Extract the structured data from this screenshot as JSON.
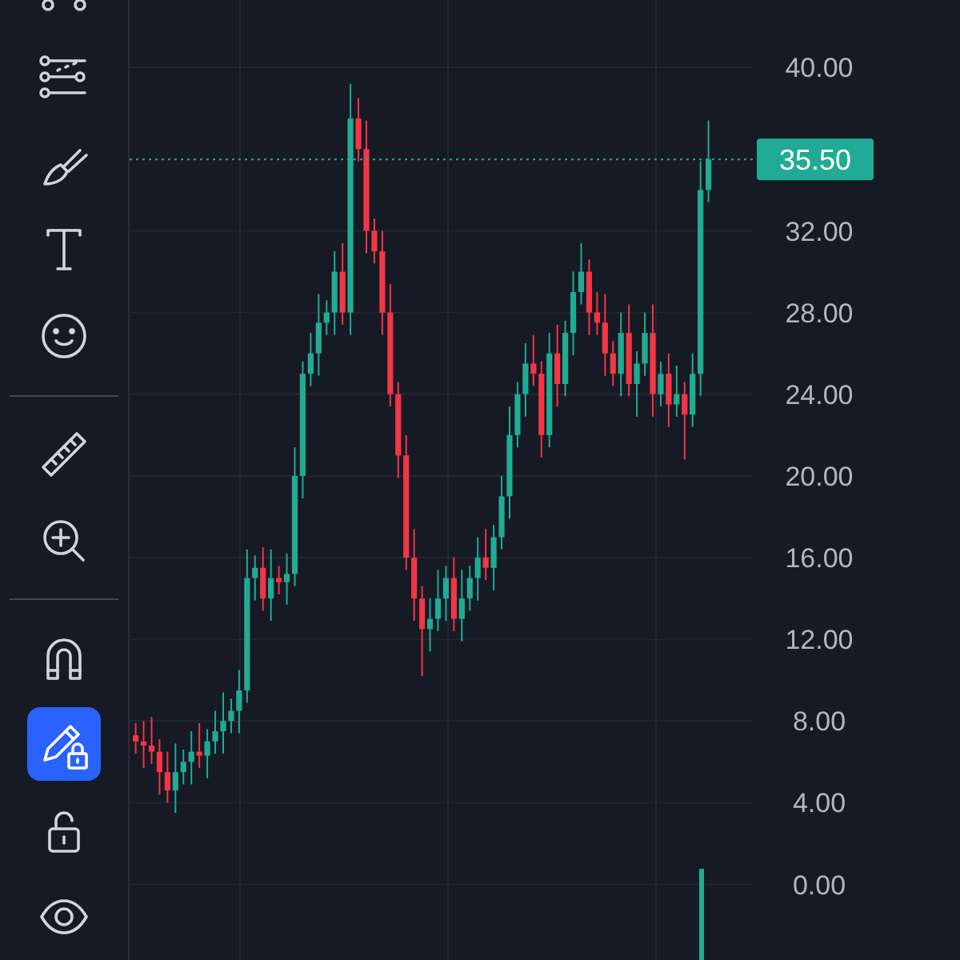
{
  "toolbar": {
    "tools": [
      {
        "kind": "nodes",
        "selected": false
      },
      {
        "kind": "fib",
        "selected": false
      },
      {
        "kind": "brush",
        "selected": false
      },
      {
        "kind": "text",
        "selected": false
      },
      {
        "kind": "emoji",
        "selected": false
      },
      {
        "kind": "separator"
      },
      {
        "kind": "ruler",
        "selected": false
      },
      {
        "kind": "zoom",
        "selected": false
      },
      {
        "kind": "separator"
      },
      {
        "kind": "magnet",
        "selected": false
      },
      {
        "kind": "lockdraw",
        "selected": true
      },
      {
        "kind": "unlock",
        "selected": false
      },
      {
        "kind": "eye",
        "selected": false
      }
    ]
  },
  "chart": {
    "chart_data": {
      "type": "candlestick",
      "ylim": [
        -3.7,
        43.3
      ],
      "yticks": [
        {
          "value": 40,
          "label": "40.00"
        },
        {
          "value": 32,
          "label": "32.00"
        },
        {
          "value": 28,
          "label": "28.00"
        },
        {
          "value": 24,
          "label": "24.00"
        },
        {
          "value": 20,
          "label": "20.00"
        },
        {
          "value": 16,
          "label": "16.00"
        },
        {
          "value": 12,
          "label": "12.00"
        },
        {
          "value": 8,
          "label": "8.00"
        },
        {
          "value": 4,
          "label": "4.00"
        },
        {
          "value": 0,
          "label": "0.00"
        }
      ],
      "ohlc": [
        [
          7.3,
          7.9,
          6.4,
          7
        ],
        [
          7,
          8,
          5.7,
          6.8
        ],
        [
          6.8,
          8.2,
          5.9,
          6.5
        ],
        [
          6.5,
          7.1,
          4.4,
          5.5
        ],
        [
          5.5,
          6.5,
          4,
          4.6
        ],
        [
          4.6,
          6.9,
          3.5,
          5.5
        ],
        [
          5.5,
          6.6,
          4.9,
          6
        ],
        [
          6,
          7.5,
          4.9,
          6.5
        ],
        [
          6.5,
          7.9,
          5.7,
          6.3
        ],
        [
          6.3,
          7.6,
          5.2,
          7
        ],
        [
          7,
          8.5,
          6.4,
          7.5
        ],
        [
          7.5,
          9.4,
          6.4,
          8
        ],
        [
          8,
          9.1,
          7.4,
          8.5
        ],
        [
          8.5,
          10.5,
          7.4,
          9.5
        ],
        [
          9.5,
          16.4,
          8.9,
          15
        ],
        [
          15,
          16.1,
          13.9,
          15.5
        ],
        [
          15.5,
          16.5,
          13.4,
          14
        ],
        [
          14,
          16.4,
          12.9,
          15
        ],
        [
          15,
          15.6,
          14.2,
          14.8
        ],
        [
          14.8,
          16.2,
          13.7,
          15.2
        ],
        [
          15.2,
          21.4,
          14.6,
          20
        ],
        [
          20,
          25.6,
          18.9,
          25
        ],
        [
          25,
          27,
          24.4,
          26
        ],
        [
          26,
          28.9,
          24.9,
          27.5
        ],
        [
          27.5,
          28.6,
          26.9,
          28
        ],
        [
          28,
          31,
          26.9,
          30
        ],
        [
          30,
          31.4,
          27.4,
          28
        ],
        [
          28,
          39.2,
          26.9,
          37.5
        ],
        [
          37.5,
          38.5,
          35.4,
          36
        ],
        [
          36,
          37.4,
          30.9,
          32
        ],
        [
          32,
          32.6,
          30.4,
          31
        ],
        [
          31,
          32,
          26.9,
          28
        ],
        [
          28,
          29.4,
          23.4,
          24
        ],
        [
          24,
          24.6,
          19.9,
          21
        ],
        [
          21,
          22,
          15.4,
          16
        ],
        [
          16,
          17.4,
          12.9,
          14
        ],
        [
          14,
          14.6,
          10.2,
          12.5
        ],
        [
          12.5,
          14,
          11.4,
          13
        ],
        [
          13,
          15.4,
          12.4,
          14
        ],
        [
          14,
          15.6,
          12.9,
          15
        ],
        [
          15,
          16,
          12.4,
          13
        ],
        [
          13,
          15.4,
          11.9,
          14
        ],
        [
          14,
          15.6,
          13.4,
          15
        ],
        [
          15,
          17,
          13.9,
          16
        ],
        [
          16,
          17.4,
          14.9,
          15.5
        ],
        [
          15.5,
          17.6,
          14.4,
          17
        ],
        [
          17,
          20,
          16.4,
          19
        ],
        [
          19,
          23.4,
          17.9,
          22
        ],
        [
          22,
          24.6,
          21.4,
          24
        ],
        [
          24,
          26.5,
          22.9,
          25.5
        ],
        [
          25.5,
          26.9,
          24.4,
          25
        ],
        [
          25,
          25.6,
          20.9,
          22
        ],
        [
          22,
          27,
          21.4,
          26
        ],
        [
          26,
          27.4,
          23.4,
          24.5
        ],
        [
          24.5,
          27.6,
          23.9,
          27
        ],
        [
          27,
          30,
          25.9,
          29
        ],
        [
          29,
          31.4,
          28.4,
          30
        ],
        [
          30,
          30.6,
          26.9,
          28
        ],
        [
          28,
          29,
          26.9,
          27.5
        ],
        [
          27.5,
          28.9,
          24.9,
          26
        ],
        [
          26,
          26.6,
          24.4,
          25
        ],
        [
          25,
          28,
          23.9,
          27
        ],
        [
          27,
          28.4,
          23.9,
          24.5
        ],
        [
          24.5,
          26.1,
          22.9,
          25.5
        ],
        [
          25.5,
          28,
          24.9,
          27
        ],
        [
          27,
          28.4,
          22.9,
          24
        ],
        [
          24,
          25.6,
          23.4,
          25
        ],
        [
          25,
          26,
          22.4,
          23.5
        ],
        [
          23.5,
          25.4,
          22.9,
          24
        ],
        [
          24,
          24.6,
          20.8,
          23
        ],
        [
          23,
          26,
          22.4,
          25
        ],
        [
          25,
          35.4,
          23.9,
          34
        ],
        [
          34,
          37.4,
          33.4,
          35.5
        ]
      ],
      "grid": true,
      "ref_lines": [
        {
          "axis": "y",
          "value": 35.5,
          "label": "35.50",
          "color": "#22ab94"
        }
      ]
    }
  }
}
